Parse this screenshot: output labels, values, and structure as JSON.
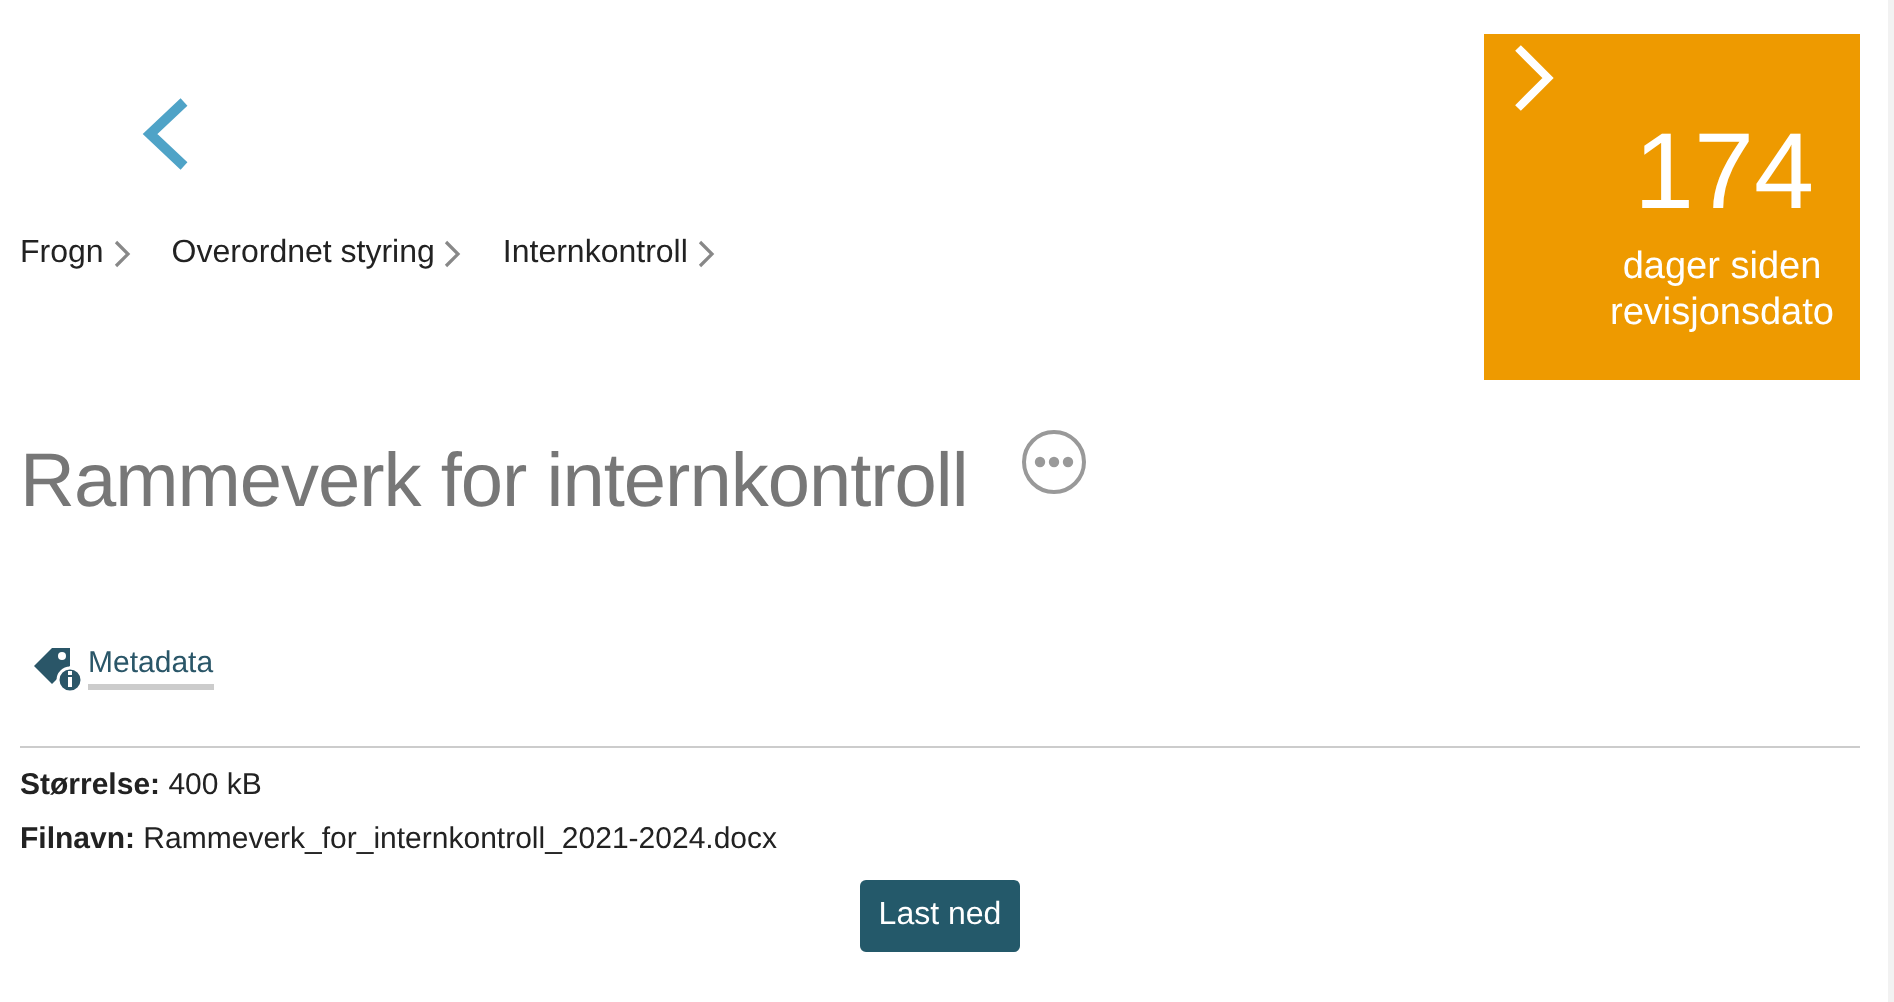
{
  "breadcrumb": [
    {
      "label": "Frogn"
    },
    {
      "label": "Overordnet styring"
    },
    {
      "label": "Internkontroll"
    }
  ],
  "counter": {
    "value": "174",
    "caption": "dager siden revisjonsdato"
  },
  "title": "Rammeverk for internkontroll",
  "metadata_link": "Metadata",
  "fields": [
    {
      "label": "Størrelse:",
      "value": "400 kB"
    },
    {
      "label": "Filnavn:",
      "value": "Rammeverk_for_internkontroll_2021-2024.docx"
    }
  ],
  "download_button": "Last ned"
}
